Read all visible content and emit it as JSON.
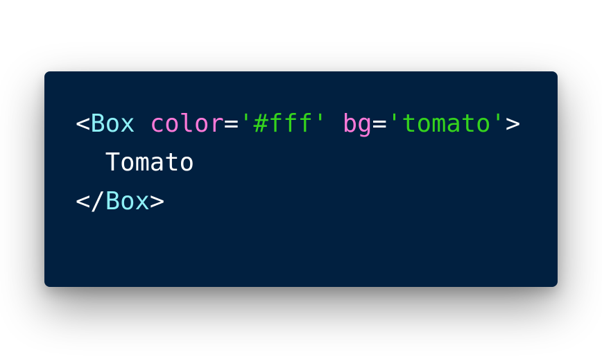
{
  "colors": {
    "background": "#ffffff",
    "card": "#012040",
    "punctuation": "#ffffff",
    "tag": "#8ef0f7",
    "attribute": "#ff7ad9",
    "string": "#35d31d",
    "text": "#ffffff"
  },
  "code": {
    "line1": {
      "open_bracket": "<",
      "tag": "Box",
      "attr1_name": "color",
      "attr1_eq": "=",
      "attr1_value": "'#fff'",
      "attr2_name": "bg",
      "attr2_eq": "=",
      "attr2_value": "'tomato'",
      "close_bracket": ">"
    },
    "line2": {
      "indent": "  ",
      "text": "Tomato"
    },
    "line3": {
      "open_bracket": "</",
      "tag": "Box",
      "close_bracket": ">"
    }
  }
}
